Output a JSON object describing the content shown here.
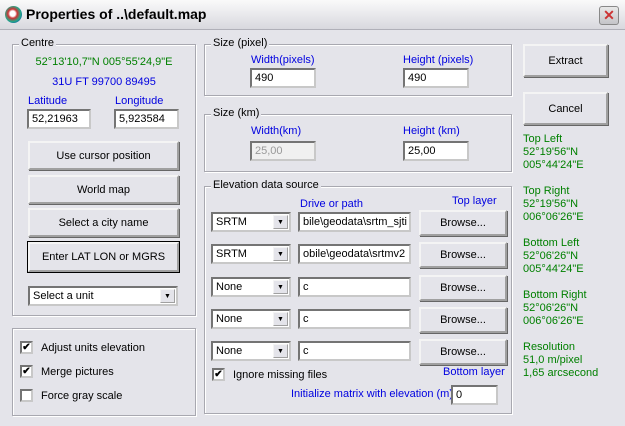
{
  "window": {
    "title": "Properties of ..\\default.map",
    "close": "✕"
  },
  "centre": {
    "label": "Centre",
    "dms": "52°13'10,7\"N 005°55'24,9\"E",
    "mgrs": "31U FT 99700 89495",
    "lat_label": "Latitude",
    "lon_label": "Longitude",
    "lat": "52,21963",
    "lon": "5,923584",
    "buttons": [
      "Use cursor position",
      "World map",
      "Select a city name",
      "Enter LAT LON or MGRS"
    ],
    "unit": "Select a unit"
  },
  "options": [
    {
      "label": "Adjust units elevation",
      "checked": true
    },
    {
      "label": "Merge pictures",
      "checked": true
    },
    {
      "label": "Force gray scale",
      "checked": false
    }
  ],
  "size_pixel": {
    "label": "Size (pixel)",
    "width_label": "Width(pixels)",
    "height_label": "Height (pixels)",
    "width": "490",
    "height": "490"
  },
  "size_km": {
    "label": "Size (km)",
    "width_label": "Width(km)",
    "height_label": "Height (km)",
    "width": "25,00",
    "height": "25,00"
  },
  "elevation": {
    "label": "Elevation data source",
    "path_label": "Drive or path",
    "top_label": "Top layer",
    "bottom_label": "Bottom layer",
    "rows": [
      {
        "source": "SRTM",
        "path": "bile\\geodata\\srtm_sjti",
        "browse": "Browse..."
      },
      {
        "source": "SRTM",
        "path": "obile\\geodata\\srtmv2",
        "browse": "Browse..."
      },
      {
        "source": "None",
        "path": "c",
        "browse": "Browse..."
      },
      {
        "source": "None",
        "path": "c",
        "browse": "Browse..."
      },
      {
        "source": "None",
        "path": "c",
        "browse": "Browse..."
      }
    ],
    "ignore_label": "Ignore missing files",
    "ignore_checked": true,
    "init_label": "Initialize matrix with elevation (m)",
    "init_value": "0"
  },
  "actions": {
    "extract": "Extract",
    "cancel": "Cancel"
  },
  "corners": [
    {
      "label": "Top Left",
      "lat": "52°19'56\"N",
      "lon": "005°44'24\"E"
    },
    {
      "label": "Top Right",
      "lat": "52°19'56\"N",
      "lon": "006°06'26\"E"
    },
    {
      "label": "Bottom Left",
      "lat": "52°06'26\"N",
      "lon": "005°44'24\"E"
    },
    {
      "label": "Bottom Right",
      "lat": "52°06'26\"N",
      "lon": "006°06'26\"E"
    }
  ],
  "resolution": {
    "label": "Resolution",
    "meters": "51,0 m/pixel",
    "arcsec": "1,65 arcsecond"
  }
}
